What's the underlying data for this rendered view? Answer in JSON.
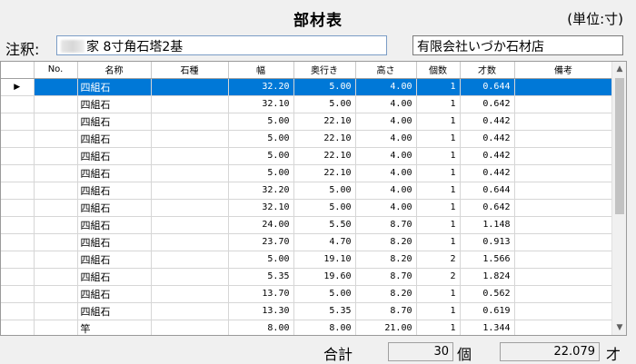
{
  "header": {
    "title": "部材表",
    "unit": "(単位:寸)"
  },
  "note": {
    "label": "注釈:",
    "value": "家 8寸角石塔2基"
  },
  "company": {
    "value": "有限会社いづか石材店"
  },
  "table": {
    "columns": [
      "",
      "No.",
      "名称",
      "石種",
      "幅",
      "奥行き",
      "高さ",
      "個数",
      "才数",
      "備考"
    ],
    "rows": [
      {
        "no": "",
        "name": "四組石",
        "stone": "",
        "width": "32.20",
        "depth": "5.00",
        "height": "4.00",
        "count": "1",
        "sai": "0.644",
        "note": ""
      },
      {
        "no": "",
        "name": "四組石",
        "stone": "",
        "width": "32.10",
        "depth": "5.00",
        "height": "4.00",
        "count": "1",
        "sai": "0.642",
        "note": ""
      },
      {
        "no": "",
        "name": "四組石",
        "stone": "",
        "width": "5.00",
        "depth": "22.10",
        "height": "4.00",
        "count": "1",
        "sai": "0.442",
        "note": ""
      },
      {
        "no": "",
        "name": "四組石",
        "stone": "",
        "width": "5.00",
        "depth": "22.10",
        "height": "4.00",
        "count": "1",
        "sai": "0.442",
        "note": ""
      },
      {
        "no": "",
        "name": "四組石",
        "stone": "",
        "width": "5.00",
        "depth": "22.10",
        "height": "4.00",
        "count": "1",
        "sai": "0.442",
        "note": ""
      },
      {
        "no": "",
        "name": "四組石",
        "stone": "",
        "width": "5.00",
        "depth": "22.10",
        "height": "4.00",
        "count": "1",
        "sai": "0.442",
        "note": ""
      },
      {
        "no": "",
        "name": "四組石",
        "stone": "",
        "width": "32.20",
        "depth": "5.00",
        "height": "4.00",
        "count": "1",
        "sai": "0.644",
        "note": ""
      },
      {
        "no": "",
        "name": "四組石",
        "stone": "",
        "width": "32.10",
        "depth": "5.00",
        "height": "4.00",
        "count": "1",
        "sai": "0.642",
        "note": ""
      },
      {
        "no": "",
        "name": "四組石",
        "stone": "",
        "width": "24.00",
        "depth": "5.50",
        "height": "8.70",
        "count": "1",
        "sai": "1.148",
        "note": ""
      },
      {
        "no": "",
        "name": "四組石",
        "stone": "",
        "width": "23.70",
        "depth": "4.70",
        "height": "8.20",
        "count": "1",
        "sai": "0.913",
        "note": ""
      },
      {
        "no": "",
        "name": "四組石",
        "stone": "",
        "width": "5.00",
        "depth": "19.10",
        "height": "8.20",
        "count": "2",
        "sai": "1.566",
        "note": ""
      },
      {
        "no": "",
        "name": "四組石",
        "stone": "",
        "width": "5.35",
        "depth": "19.60",
        "height": "8.70",
        "count": "2",
        "sai": "1.824",
        "note": ""
      },
      {
        "no": "",
        "name": "四組石",
        "stone": "",
        "width": "13.70",
        "depth": "5.00",
        "height": "8.20",
        "count": "1",
        "sai": "0.562",
        "note": ""
      },
      {
        "no": "",
        "name": "四組石",
        "stone": "",
        "width": "13.30",
        "depth": "5.35",
        "height": "8.70",
        "count": "1",
        "sai": "0.619",
        "note": ""
      },
      {
        "no": "",
        "name": "竿",
        "stone": "",
        "width": "8.00",
        "depth": "8.00",
        "height": "21.00",
        "count": "1",
        "sai": "1.344",
        "note": ""
      }
    ],
    "selected_row_marker": "▶"
  },
  "totals": {
    "label": "合計",
    "count": "30",
    "count_unit": "個",
    "sai": "22.079",
    "sai_unit": "才"
  },
  "colors": {
    "selection": "#0078d7",
    "field_border_focus": "#7a9cc6"
  },
  "icons": {
    "scroll_up": "chevron-up-icon",
    "scroll_down": "chevron-down-icon",
    "row_indicator": "triangle-right-icon"
  }
}
